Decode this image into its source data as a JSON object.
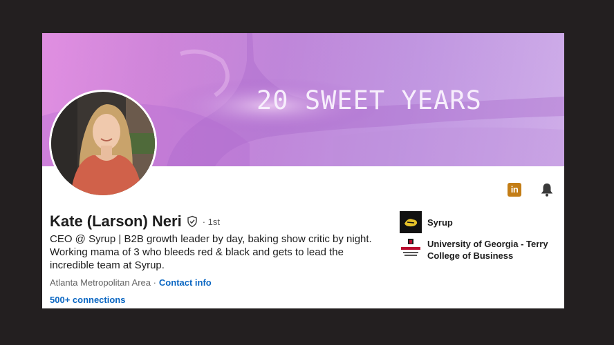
{
  "banner": {
    "text": "20 SWEET YEARS"
  },
  "profile": {
    "name": "Kate (Larson) Neri",
    "degree": "· 1st",
    "headline": "CEO @ Syrup | B2B growth leader by day, baking show critic by night. Working mama of 3 who bleeds red & black and gets to lead the incredible team at Syrup.",
    "location": "Atlanta Metropolitan Area ·",
    "contact_info": "Contact info",
    "connections": "500+ connections"
  },
  "actions": {
    "linkedin_badge": "in",
    "icons": [
      "linkedin-premium-icon",
      "bell-icon"
    ]
  },
  "orgs": [
    {
      "name": "Syrup",
      "logo": "syrup-logo"
    },
    {
      "name": "University of Georgia - Terry College of Business",
      "logo": "uga-terry-logo"
    }
  ],
  "colors": {
    "background": "#231f20",
    "link": "#0a66c2",
    "banner_accent": "#c97fd6",
    "premium_badge": "#c37d16"
  }
}
